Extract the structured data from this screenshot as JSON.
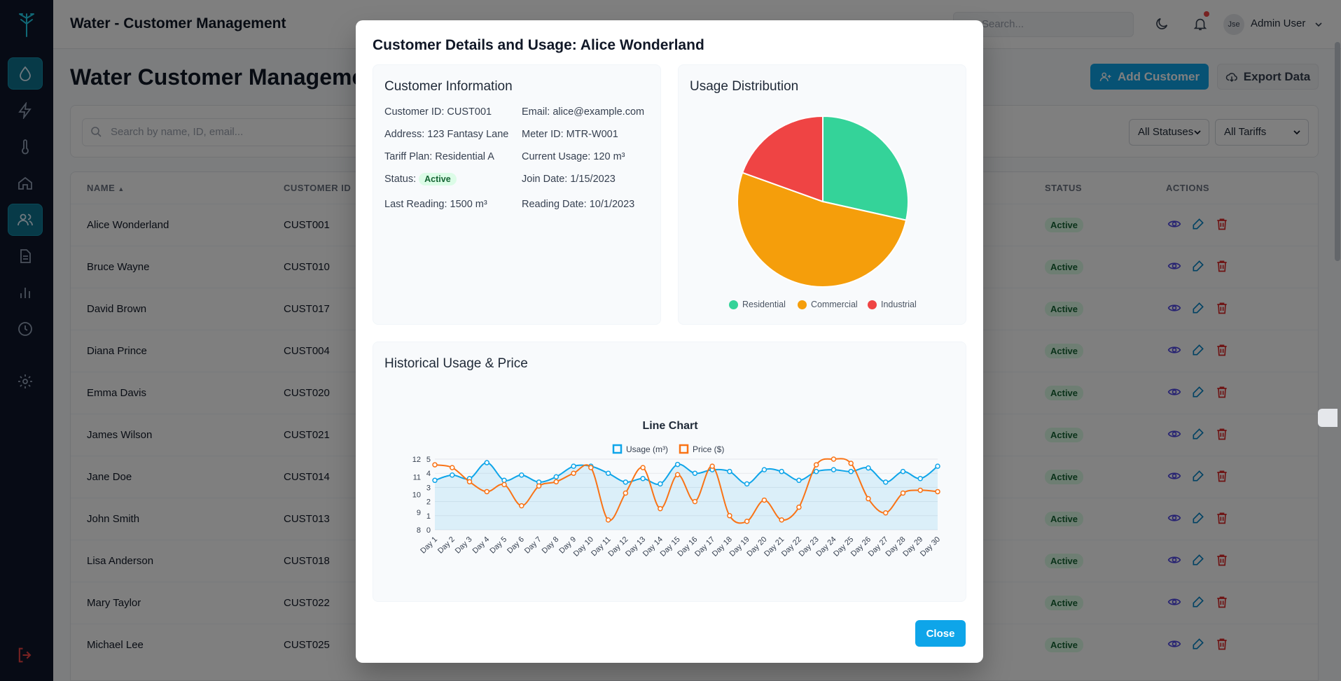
{
  "app": {
    "title": "Water - Customer Management",
    "search_placeholder": "Search...",
    "user_name": "Admin User",
    "avatar_text": "Jse"
  },
  "sidebar": {
    "items": [
      {
        "icon": "droplet-icon",
        "active": true
      },
      {
        "icon": "bolt-icon",
        "active": false
      },
      {
        "icon": "thermometer-icon",
        "active": false
      },
      {
        "icon": "home-icon",
        "active": false
      },
      {
        "icon": "users-icon",
        "active": true
      },
      {
        "icon": "document-icon",
        "active": false
      },
      {
        "icon": "bar-chart-icon",
        "active": false
      },
      {
        "icon": "clock-icon",
        "active": false
      },
      {
        "icon": "gear-icon",
        "active": false
      }
    ],
    "logout_icon": "logout-icon"
  },
  "page": {
    "title": "Water Customer Management",
    "add_button": "Add Customer",
    "export_button": "Export Data",
    "search_placeholder": "Search by name, ID, email...",
    "status_filter": "All Statuses",
    "tariff_filter": "All Tariffs",
    "columns": {
      "name": "NAME",
      "customer_id": "CUSTOMER ID",
      "status": "STATUS",
      "actions": "ACTIONS"
    },
    "rows": [
      {
        "name": "Alice Wonderland",
        "id": "CUST001",
        "status": "Active"
      },
      {
        "name": "Bruce Wayne",
        "id": "CUST010",
        "status": "Active"
      },
      {
        "name": "David Brown",
        "id": "CUST017",
        "status": "Active"
      },
      {
        "name": "Diana Prince",
        "id": "CUST004",
        "status": "Active"
      },
      {
        "name": "Emma Davis",
        "id": "CUST020",
        "status": "Active"
      },
      {
        "name": "James Wilson",
        "id": "CUST021",
        "status": "Active"
      },
      {
        "name": "Jane Doe",
        "id": "CUST014",
        "status": "Active"
      },
      {
        "name": "John Smith",
        "id": "CUST013",
        "status": "Active"
      },
      {
        "name": "Lisa Anderson",
        "id": "CUST018",
        "status": "Active"
      },
      {
        "name": "Mary Taylor",
        "id": "CUST022",
        "status": "Active"
      },
      {
        "name": "Michael Lee",
        "id": "CUST025",
        "status": "Active"
      }
    ]
  },
  "modal": {
    "title": "Customer Details and Usage: Alice Wonderland",
    "info_title": "Customer Information",
    "info": {
      "customer_id": "Customer ID: CUST001",
      "email": "Email: alice@example.com",
      "address": "Address: 123 Fantasy Lane",
      "meter_id": "Meter ID: MTR-W001",
      "tariff": "Tariff Plan: Residential A",
      "current_usage": "Current Usage: 120 m³",
      "status_label": "Status:",
      "status_value": "Active",
      "join_date": "Join Date: 1/15/2023",
      "last_reading": "Last Reading: 1500 m³",
      "reading_date": "Reading Date: 10/1/2023"
    },
    "distribution_title": "Usage Distribution",
    "history_title": "Historical Usage & Price",
    "close_button": "Close"
  },
  "chart_data": [
    {
      "type": "pie",
      "categories": [
        "Residential",
        "Commercial",
        "Industrial"
      ],
      "values": [
        28.5,
        52,
        19.5
      ],
      "colors": [
        "#34d399",
        "#f59e0b",
        "#ef4444"
      ],
      "legend": "bottom"
    },
    {
      "type": "line",
      "title": "Line Chart",
      "x": [
        "Day 1",
        "Day 2",
        "Day 3",
        "Day 4",
        "Day 5",
        "Day 6",
        "Day 7",
        "Day 8",
        "Day 9",
        "Day 10",
        "Day 11",
        "Day 12",
        "Day 13",
        "Day 14",
        "Day 15",
        "Day 16",
        "Day 17",
        "Day 18",
        "Day 19",
        "Day 20",
        "Day 21",
        "Day 22",
        "Day 23",
        "Day 24",
        "Day 25",
        "Day 26",
        "Day 27",
        "Day 28",
        "Day 29",
        "Day 30"
      ],
      "series": [
        {
          "name": "Usage (m³)",
          "color": "#0ea5e9",
          "axis": "left",
          "fill": true,
          "values": [
            10.8,
            11.1,
            10.9,
            11.8,
            10.8,
            11.1,
            10.7,
            11.0,
            11.6,
            11.6,
            11.2,
            10.7,
            10.9,
            10.6,
            11.7,
            11.2,
            11.4,
            11.3,
            10.6,
            11.4,
            11.3,
            10.8,
            11.3,
            11.4,
            11.3,
            11.5,
            10.7,
            11.3,
            10.9,
            11.6
          ]
        },
        {
          "name": "Price ($)",
          "color": "#f97316",
          "axis": "right",
          "fill": false,
          "values": [
            4.6,
            4.4,
            3.4,
            2.7,
            3.2,
            1.7,
            3.1,
            3.4,
            4.0,
            4.4,
            0.7,
            2.6,
            4.4,
            1.5,
            3.9,
            2.0,
            4.5,
            1.0,
            0.6,
            2.1,
            0.7,
            1.6,
            4.6,
            5.0,
            4.7,
            2.2,
            1.2,
            2.6,
            2.8,
            2.7
          ]
        }
      ],
      "y_left": {
        "ticks": [
          8,
          9,
          10,
          11,
          12
        ],
        "range": [
          8,
          12
        ]
      },
      "y_right": {
        "ticks": [
          0,
          1,
          2,
          3,
          4,
          5
        ],
        "range": [
          0,
          5
        ]
      },
      "legend": "top",
      "grid": true
    }
  ]
}
